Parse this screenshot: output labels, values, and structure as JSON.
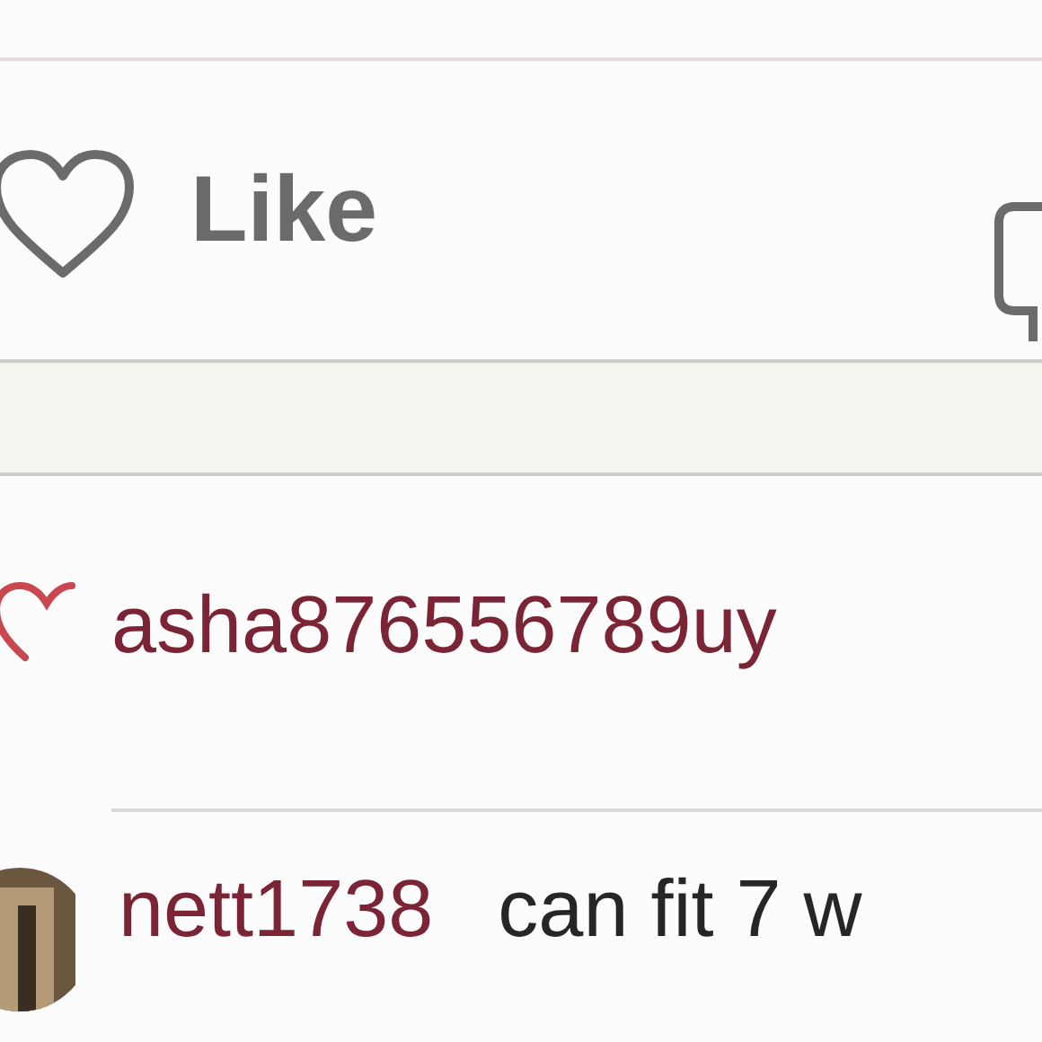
{
  "actions": [
    {
      "label": "Like"
    }
  ],
  "comments": [
    {
      "kind": "like",
      "username": "asha876556789uy"
    },
    {
      "kind": "comment",
      "username": "nett1738",
      "text": "can fit 7 w"
    }
  ]
}
